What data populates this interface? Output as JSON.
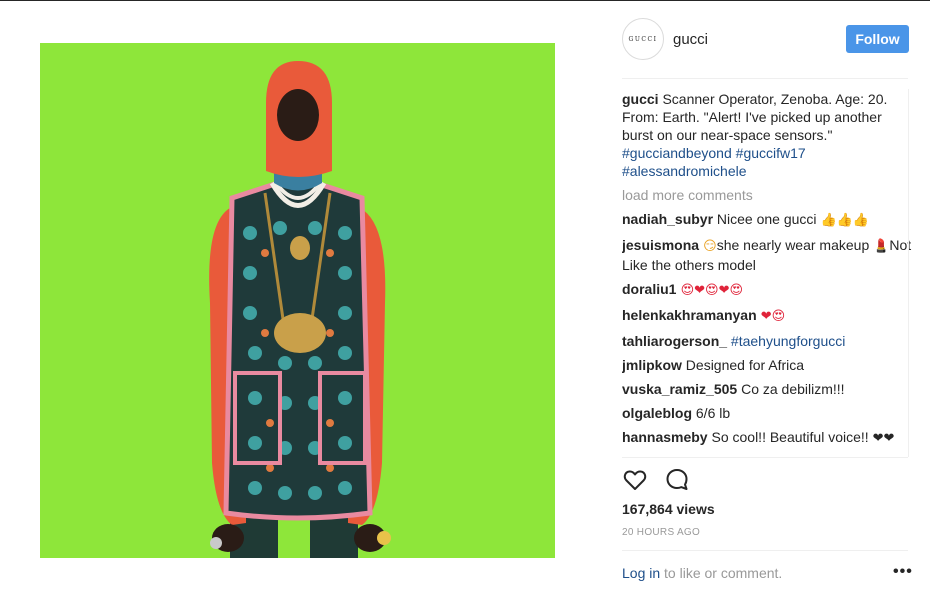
{
  "post": {
    "image_alt": "Model in green-screen studio wearing red balaclava, pearl necklaces and patterned vest"
  },
  "header": {
    "avatar_text": "GUCCI",
    "username": "gucci",
    "follow_label": "Follow"
  },
  "caption": {
    "username": "gucci",
    "text": " Scanner Operator, Zenoba. Age: 20. From: Earth. \"Alert! I've picked up another burst on our near-space sensors.\" ",
    "tags": [
      "#gucciandbeyond",
      "#guccifw17",
      "#alessandromichele"
    ]
  },
  "load_more": "load more comments",
  "comments": [
    {
      "user": "nadiah_subyr",
      "text": " Nicee one gucci ",
      "emoji": "👍👍👍"
    },
    {
      "user": "jesuismona",
      "emoji_pre": " 😏",
      "text": "she nearly wear makeup ",
      "emoji_mid": "💄",
      "text2": "Not Like the others model"
    },
    {
      "user": "doraliu1",
      "emoji": " 😍❤😍❤😍"
    },
    {
      "user": "helenkakhramanyan",
      "emoji": " ❤😍"
    },
    {
      "user": "tahliarogerson_",
      "tag": " #taehyungforgucci"
    },
    {
      "user": "jmlipkow",
      "text": " Designed for Africa"
    },
    {
      "user": "vuska_ramiz_505",
      "text": " Co za debilizm!!!"
    },
    {
      "user": "olgaleblog",
      "text": " 6/6 lb"
    },
    {
      "user": "hannasmeby",
      "text": " So cool!! Beautiful voice!! ",
      "emoji": "❤❤"
    }
  ],
  "stats": {
    "views": "167,864 views",
    "time_ago": "20 HOURS AGO"
  },
  "footer": {
    "login_link": "Log in",
    "login_rest": " to like or comment.",
    "more": "•••"
  },
  "icons": {
    "like": "heart-outline-icon",
    "comment": "speech-bubble-icon"
  },
  "colors": {
    "follow_bg": "#4a95e8",
    "hashtag": "#1e4f8a",
    "muted": "#999999",
    "backdrop": "#8ee63a"
  }
}
